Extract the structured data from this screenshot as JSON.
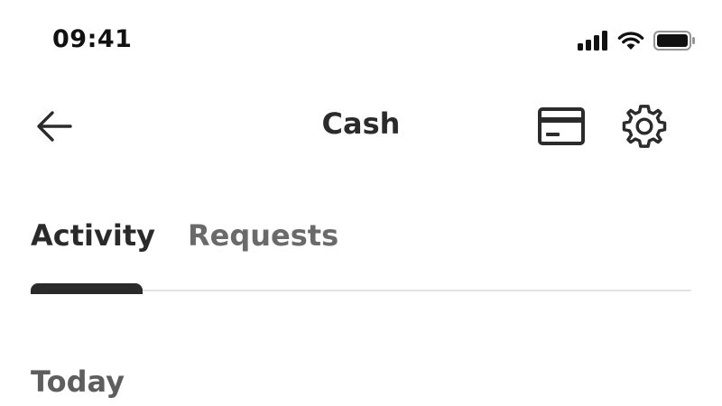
{
  "status_bar": {
    "time": "09:41",
    "icons": [
      "cellular-signal-icon",
      "wifi-icon",
      "battery-icon"
    ]
  },
  "header": {
    "title": "Cash",
    "icons": [
      "back-arrow-icon",
      "credit-card-icon",
      "gear-icon"
    ]
  },
  "tabs": [
    {
      "label": "Activity",
      "selected": true
    },
    {
      "label": "Requests",
      "selected": false
    }
  ],
  "sections": [
    {
      "label": "Today"
    }
  ],
  "colors": {
    "text_primary": "#2a2a2a",
    "text_muted": "#6a6a6a",
    "divider": "#e2e2e2",
    "background": "#ffffff"
  }
}
